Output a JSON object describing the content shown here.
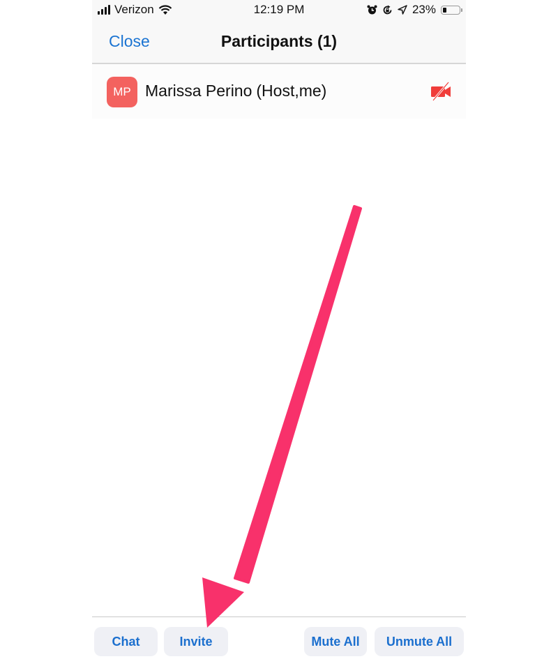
{
  "status_bar": {
    "carrier": "Verizon",
    "time": "12:19 PM",
    "battery_percent_label": "23%",
    "battery_level": 0.23,
    "icons": [
      "signal-icon",
      "wifi-icon",
      "alarm-icon",
      "rotation-lock-icon",
      "location-icon",
      "battery-icon"
    ]
  },
  "navbar": {
    "close_label": "Close",
    "title": "Participants (1)"
  },
  "participants": [
    {
      "initials": "MP",
      "name": "Marissa Perino",
      "role": "(Host,me)",
      "avatar_color": "#f3625f",
      "video_status_icon": "video-off-icon",
      "video_icon_color": "#f03d3a"
    }
  ],
  "footer": {
    "chat_label": "Chat",
    "invite_label": "Invite",
    "mute_all_label": "Mute All",
    "unmute_all_label": "Unmute All"
  },
  "annotation": {
    "type": "arrow",
    "points_to": "Invite",
    "color": "#f8316b"
  },
  "colors": {
    "accent": "#1b74d2",
    "button_bg": "#eff0f5",
    "navbar_bg": "#f8f8f8"
  }
}
